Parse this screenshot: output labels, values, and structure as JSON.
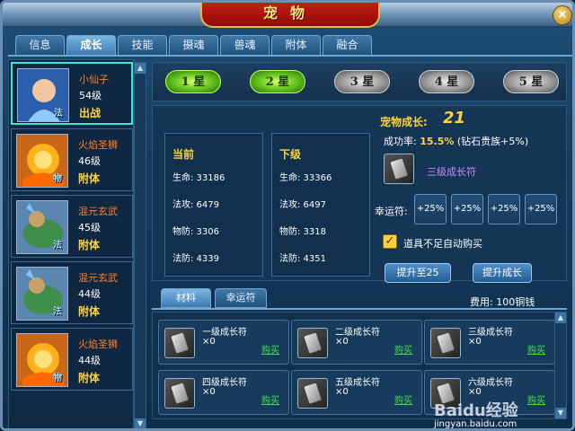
{
  "window": {
    "title": "宠物",
    "close_label": "×"
  },
  "tabs": [
    "信息",
    "成长",
    "技能",
    "摄魂",
    "兽魂",
    "附体",
    "融合"
  ],
  "active_tab": 1,
  "pets": [
    {
      "name": "小仙子",
      "level": "54级",
      "status": "出战",
      "tag": "法",
      "selected": true,
      "colors": [
        "#3a7bd5",
        "#f2c7a0",
        "#8ec9ff"
      ]
    },
    {
      "name": "火焰圣狮",
      "level": "46级",
      "status": "附体",
      "tag": "物",
      "selected": false,
      "colors": [
        "#ffb21a",
        "#ff6a00",
        "#ffe27a"
      ]
    },
    {
      "name": "混元玄武",
      "level": "45级",
      "status": "附体",
      "tag": "法",
      "selected": false,
      "colors": [
        "#3f8f4a",
        "#c9a066",
        "#7ec3ff"
      ]
    },
    {
      "name": "混元玄武",
      "level": "44级",
      "status": "附体",
      "tag": "法",
      "selected": false,
      "colors": [
        "#3f8f4a",
        "#c9a066",
        "#7ec3ff"
      ]
    },
    {
      "name": "火焰圣狮",
      "level": "44级",
      "status": "附体",
      "tag": "物",
      "selected": false,
      "colors": [
        "#ffb21a",
        "#ff6a00",
        "#ffe27a"
      ]
    }
  ],
  "stars": [
    {
      "label": "1 星",
      "lit": true
    },
    {
      "label": "2 星",
      "lit": true
    },
    {
      "label": "3 星",
      "lit": false
    },
    {
      "label": "4 星",
      "lit": false
    },
    {
      "label": "5 星",
      "lit": false
    }
  ],
  "current": {
    "title": "当前",
    "stats": [
      "生命: 33186",
      "法攻: 6479",
      "物防: 3306",
      "法防: 4339"
    ]
  },
  "next": {
    "title": "下级",
    "stats": [
      "生命: 33366",
      "法攻: 6497",
      "物防: 3318",
      "法防: 4351"
    ]
  },
  "growth": {
    "label": "宠物成长:",
    "value": "21"
  },
  "success_rate": {
    "label": "成功率:",
    "value": "15.5%",
    "note": "(钻石贵族+5%)"
  },
  "required_item": "三级成长符",
  "luck": {
    "label": "幸运符:",
    "buttons": [
      "+25%",
      "+25%",
      "+25%",
      "+25%"
    ]
  },
  "auto_buy": {
    "checked": true,
    "label": "道具不足自动购买"
  },
  "actions": {
    "upgrade_to": "提升至25",
    "upgrade": "提升成长"
  },
  "fee": "费用: 100铜钱",
  "bottom_tabs": [
    "材料",
    "幸运符"
  ],
  "items": [
    {
      "name": "一级成长符",
      "qty": "×0",
      "buy": "购买"
    },
    {
      "name": "二级成长符",
      "qty": "×0",
      "buy": "购买"
    },
    {
      "name": "三级成长符",
      "qty": "×0",
      "buy": "购买"
    },
    {
      "name": "四级成长符",
      "qty": "×0",
      "buy": "购买"
    },
    {
      "name": "五级成长符",
      "qty": "×0",
      "buy": "购买"
    },
    {
      "name": "六级成长符",
      "qty": "×0",
      "buy": "购买"
    }
  ],
  "watermark": {
    "brand": "Baidu经验",
    "url": "jingyan.baidu.com"
  }
}
